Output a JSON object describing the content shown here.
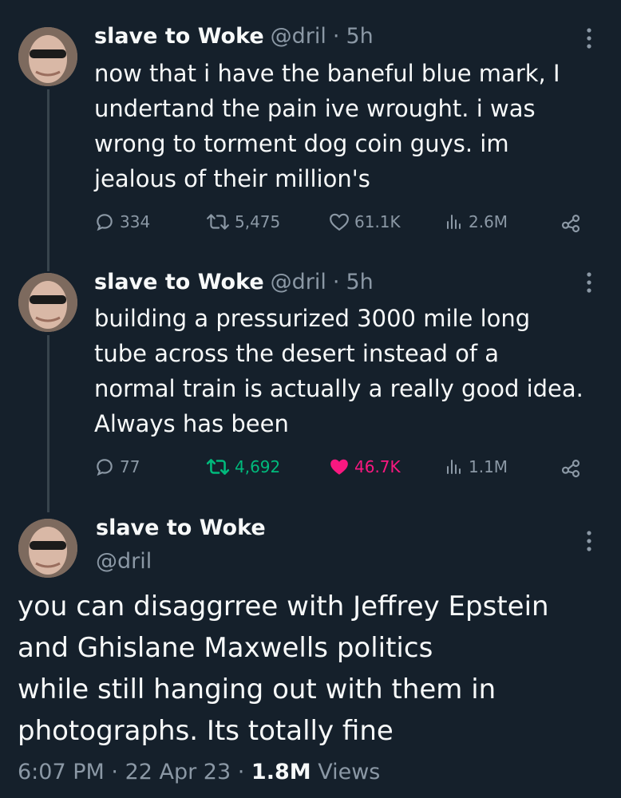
{
  "tweets": [
    {
      "name": "slave to Woke",
      "handle": "@dril",
      "time": "5h",
      "text_lines": [
        "now that i have the baneful blue mark, I",
        "undertand the pain ive wrought. i was",
        "wrong to torment dog coin guys. im",
        "jealous of their million's"
      ],
      "replies": "334",
      "retweets": "5,475",
      "likes": "61.1K",
      "views": "2.6M",
      "liked": false,
      "retweeted": false
    },
    {
      "name": "slave to Woke",
      "handle": "@dril",
      "time": "5h",
      "text_lines": [
        "building a pressurized 3000 mile long",
        "tube across the desert instead of a",
        "normal train is actually a really good idea.",
        "Always has been"
      ],
      "replies": "77",
      "retweets": "4,692",
      "likes": "46.7K",
      "views": "1.1M",
      "liked": true,
      "retweeted": true
    }
  ],
  "main": {
    "name": "slave to Woke",
    "handle": "@dril",
    "text_lines": [
      "you can disaggrree with Jeffrey Epstein",
      "and Ghislane Maxwells politics",
      "while still hanging out with them in",
      "photographs. Its totally fine"
    ],
    "time": "6:07 PM",
    "date": "22 Apr 23",
    "views_count": "1.8M",
    "views_label": "Views"
  },
  "colors": {
    "background": "#15202b",
    "text": "#f7f9f9",
    "muted": "#8b98a5",
    "retweet_active": "#00ba7c",
    "like_active": "#f91880"
  },
  "icons": [
    "reply-icon",
    "retweet-icon",
    "like-icon",
    "views-icon",
    "share-icon",
    "more-icon"
  ]
}
